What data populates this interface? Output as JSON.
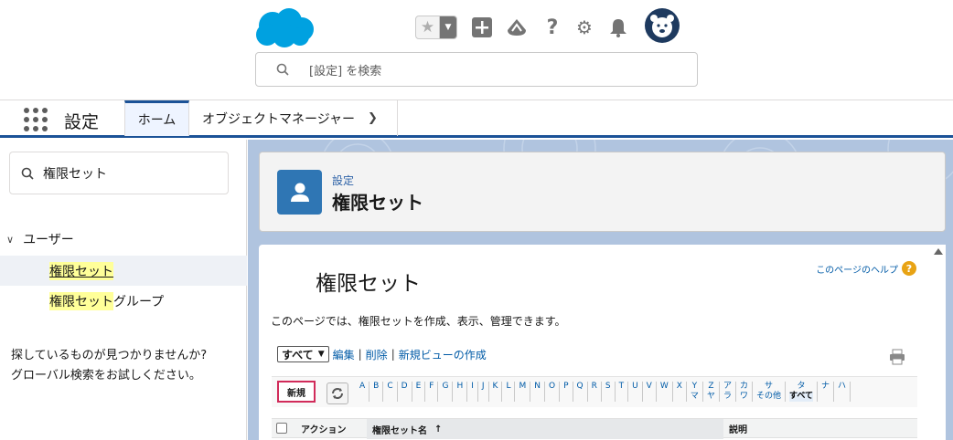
{
  "header": {
    "search_placeholder": "[設定] を検索",
    "icons": [
      "salesforce-cloud-logo",
      "favorite-star-icon",
      "favorites-dropdown-icon",
      "global-actions-plus-icon",
      "trailhead-icon",
      "help-icon",
      "setup-gear-icon",
      "notifications-bell-icon",
      "user-avatar"
    ]
  },
  "nav": {
    "app_name": "設定",
    "tabs": [
      {
        "label": "ホーム",
        "selected": true
      },
      {
        "label": "オブジェクトマネージャー",
        "selected": false
      }
    ]
  },
  "sidebar": {
    "quick_find_value": "権限セット",
    "tree_header": "ユーザー",
    "items": [
      {
        "highlight": "権限セット",
        "rest": "",
        "selected": true
      },
      {
        "highlight": "権限セット",
        "rest": "グループ",
        "selected": false
      }
    ],
    "hint_line1": "探しているものが見つかりませんか?",
    "hint_line2": "グローバル検索をお試しください。"
  },
  "page_header": {
    "breadcrumb": "設定",
    "title": "権限セット"
  },
  "content": {
    "title": "権限セット",
    "help_link": "このページのヘルプ",
    "description": "このページでは、権限セットを作成、表示、管理できます。",
    "view_select": "すべて",
    "edit_link": "編集",
    "delete_link": "削除",
    "new_view_link": "新規ビューの作成",
    "new_button": "新規",
    "letters": [
      {
        "top": "A",
        "bottom": ""
      },
      {
        "top": "B",
        "bottom": ""
      },
      {
        "top": "C",
        "bottom": ""
      },
      {
        "top": "D",
        "bottom": ""
      },
      {
        "top": "E",
        "bottom": ""
      },
      {
        "top": "F",
        "bottom": ""
      },
      {
        "top": "G",
        "bottom": ""
      },
      {
        "top": "H",
        "bottom": ""
      },
      {
        "top": "I",
        "bottom": ""
      },
      {
        "top": "J",
        "bottom": ""
      },
      {
        "top": "K",
        "bottom": ""
      },
      {
        "top": "L",
        "bottom": ""
      },
      {
        "top": "M",
        "bottom": ""
      },
      {
        "top": "N",
        "bottom": ""
      },
      {
        "top": "O",
        "bottom": ""
      },
      {
        "top": "P",
        "bottom": ""
      },
      {
        "top": "Q",
        "bottom": ""
      },
      {
        "top": "R",
        "bottom": ""
      },
      {
        "top": "S",
        "bottom": ""
      },
      {
        "top": "T",
        "bottom": ""
      },
      {
        "top": "U",
        "bottom": ""
      },
      {
        "top": "V",
        "bottom": ""
      },
      {
        "top": "W",
        "bottom": ""
      },
      {
        "top": "X",
        "bottom": ""
      },
      {
        "top": "Y",
        "bottom": "マ"
      },
      {
        "top": "Z",
        "bottom": "ヤ"
      },
      {
        "top": "ア",
        "bottom": "ラ"
      },
      {
        "top": "カ",
        "bottom": "ワ"
      },
      {
        "top": "サ",
        "bottom": "その他"
      },
      {
        "top": "タ",
        "bottom": "すべて"
      },
      {
        "top": "ナ",
        "bottom": ""
      },
      {
        "top": "ハ",
        "bottom": ""
      }
    ],
    "selected_letter": "すべて",
    "columns": {
      "action": "アクション",
      "name": "権限セット名",
      "sort_indicator": "↑",
      "description": "説明"
    }
  },
  "colors": {
    "brand_blue": "#1b5297",
    "salesforce_cloud": "#00a1e0",
    "highlight": "#ffff99",
    "new_button_border": "#d12b5a",
    "link": "#015ba7"
  }
}
